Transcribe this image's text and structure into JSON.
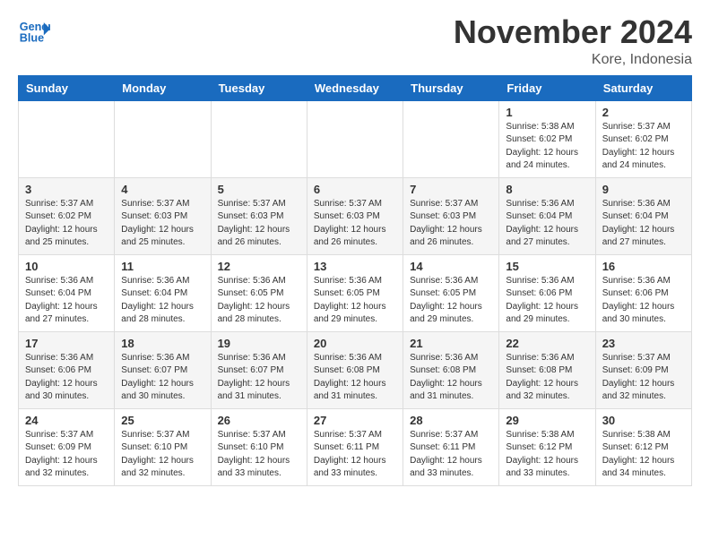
{
  "header": {
    "logo_line1": "General",
    "logo_line2": "Blue",
    "month": "November 2024",
    "location": "Kore, Indonesia"
  },
  "weekdays": [
    "Sunday",
    "Monday",
    "Tuesday",
    "Wednesday",
    "Thursday",
    "Friday",
    "Saturday"
  ],
  "weeks": [
    [
      {
        "day": "",
        "info": ""
      },
      {
        "day": "",
        "info": ""
      },
      {
        "day": "",
        "info": ""
      },
      {
        "day": "",
        "info": ""
      },
      {
        "day": "",
        "info": ""
      },
      {
        "day": "1",
        "info": "Sunrise: 5:38 AM\nSunset: 6:02 PM\nDaylight: 12 hours\nand 24 minutes."
      },
      {
        "day": "2",
        "info": "Sunrise: 5:37 AM\nSunset: 6:02 PM\nDaylight: 12 hours\nand 24 minutes."
      }
    ],
    [
      {
        "day": "3",
        "info": "Sunrise: 5:37 AM\nSunset: 6:02 PM\nDaylight: 12 hours\nand 25 minutes."
      },
      {
        "day": "4",
        "info": "Sunrise: 5:37 AM\nSunset: 6:03 PM\nDaylight: 12 hours\nand 25 minutes."
      },
      {
        "day": "5",
        "info": "Sunrise: 5:37 AM\nSunset: 6:03 PM\nDaylight: 12 hours\nand 26 minutes."
      },
      {
        "day": "6",
        "info": "Sunrise: 5:37 AM\nSunset: 6:03 PM\nDaylight: 12 hours\nand 26 minutes."
      },
      {
        "day": "7",
        "info": "Sunrise: 5:37 AM\nSunset: 6:03 PM\nDaylight: 12 hours\nand 26 minutes."
      },
      {
        "day": "8",
        "info": "Sunrise: 5:36 AM\nSunset: 6:04 PM\nDaylight: 12 hours\nand 27 minutes."
      },
      {
        "day": "9",
        "info": "Sunrise: 5:36 AM\nSunset: 6:04 PM\nDaylight: 12 hours\nand 27 minutes."
      }
    ],
    [
      {
        "day": "10",
        "info": "Sunrise: 5:36 AM\nSunset: 6:04 PM\nDaylight: 12 hours\nand 27 minutes."
      },
      {
        "day": "11",
        "info": "Sunrise: 5:36 AM\nSunset: 6:04 PM\nDaylight: 12 hours\nand 28 minutes."
      },
      {
        "day": "12",
        "info": "Sunrise: 5:36 AM\nSunset: 6:05 PM\nDaylight: 12 hours\nand 28 minutes."
      },
      {
        "day": "13",
        "info": "Sunrise: 5:36 AM\nSunset: 6:05 PM\nDaylight: 12 hours\nand 29 minutes."
      },
      {
        "day": "14",
        "info": "Sunrise: 5:36 AM\nSunset: 6:05 PM\nDaylight: 12 hours\nand 29 minutes."
      },
      {
        "day": "15",
        "info": "Sunrise: 5:36 AM\nSunset: 6:06 PM\nDaylight: 12 hours\nand 29 minutes."
      },
      {
        "day": "16",
        "info": "Sunrise: 5:36 AM\nSunset: 6:06 PM\nDaylight: 12 hours\nand 30 minutes."
      }
    ],
    [
      {
        "day": "17",
        "info": "Sunrise: 5:36 AM\nSunset: 6:06 PM\nDaylight: 12 hours\nand 30 minutes."
      },
      {
        "day": "18",
        "info": "Sunrise: 5:36 AM\nSunset: 6:07 PM\nDaylight: 12 hours\nand 30 minutes."
      },
      {
        "day": "19",
        "info": "Sunrise: 5:36 AM\nSunset: 6:07 PM\nDaylight: 12 hours\nand 31 minutes."
      },
      {
        "day": "20",
        "info": "Sunrise: 5:36 AM\nSunset: 6:08 PM\nDaylight: 12 hours\nand 31 minutes."
      },
      {
        "day": "21",
        "info": "Sunrise: 5:36 AM\nSunset: 6:08 PM\nDaylight: 12 hours\nand 31 minutes."
      },
      {
        "day": "22",
        "info": "Sunrise: 5:36 AM\nSunset: 6:08 PM\nDaylight: 12 hours\nand 32 minutes."
      },
      {
        "day": "23",
        "info": "Sunrise: 5:37 AM\nSunset: 6:09 PM\nDaylight: 12 hours\nand 32 minutes."
      }
    ],
    [
      {
        "day": "24",
        "info": "Sunrise: 5:37 AM\nSunset: 6:09 PM\nDaylight: 12 hours\nand 32 minutes."
      },
      {
        "day": "25",
        "info": "Sunrise: 5:37 AM\nSunset: 6:10 PM\nDaylight: 12 hours\nand 32 minutes."
      },
      {
        "day": "26",
        "info": "Sunrise: 5:37 AM\nSunset: 6:10 PM\nDaylight: 12 hours\nand 33 minutes."
      },
      {
        "day": "27",
        "info": "Sunrise: 5:37 AM\nSunset: 6:11 PM\nDaylight: 12 hours\nand 33 minutes."
      },
      {
        "day": "28",
        "info": "Sunrise: 5:37 AM\nSunset: 6:11 PM\nDaylight: 12 hours\nand 33 minutes."
      },
      {
        "day": "29",
        "info": "Sunrise: 5:38 AM\nSunset: 6:12 PM\nDaylight: 12 hours\nand 33 minutes."
      },
      {
        "day": "30",
        "info": "Sunrise: 5:38 AM\nSunset: 6:12 PM\nDaylight: 12 hours\nand 34 minutes."
      }
    ]
  ]
}
